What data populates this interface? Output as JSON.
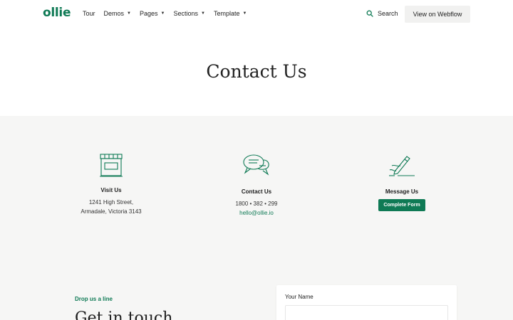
{
  "nav": {
    "logo": "ollie",
    "items": [
      {
        "label": "Tour",
        "dropdown": false
      },
      {
        "label": "Demos",
        "dropdown": true
      },
      {
        "label": "Pages",
        "dropdown": true
      },
      {
        "label": "Sections",
        "dropdown": true
      },
      {
        "label": "Template",
        "dropdown": true
      }
    ],
    "search_label": "Search",
    "cta_label": "View on Webflow"
  },
  "hero": {
    "title": "Contact Us"
  },
  "contact": {
    "visit": {
      "title": "Visit Us",
      "line1": "1241 High Street,",
      "line2": "Armadale, Victoria 3143",
      "icon": "storefront-icon"
    },
    "call": {
      "title": "Contact Us",
      "phone": "1800 • 382 • 299",
      "email": "hello@ollie.io",
      "icon": "chat-bubbles-icon"
    },
    "message": {
      "title": "Message Us",
      "button": "Complete Form",
      "icon": "pen-writing-icon"
    }
  },
  "form_section": {
    "eyebrow": "Drop us a line",
    "heading": "Get in touch",
    "name_label": "Your Name",
    "name_value": ""
  },
  "colors": {
    "accent": "#0f7a55",
    "grey_bg": "#f6f6f5",
    "button_bg": "#f1f1f0"
  }
}
